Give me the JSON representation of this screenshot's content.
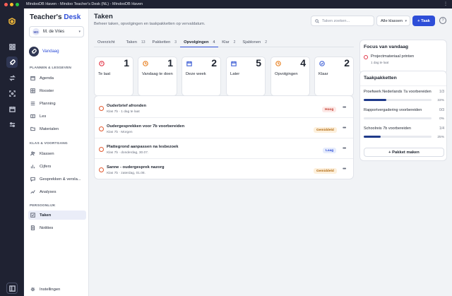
{
  "window": {
    "title": "MindooDB Haven - Mindoo Teacher's Desk (NL) - MindooDB Haven",
    "traffic": [
      "#ff5f57",
      "#febc2e",
      "#28c840"
    ]
  },
  "brand": {
    "main": "Teacher's ",
    "accent": "Desk",
    "accent_color": "#2e4ed8"
  },
  "user": {
    "initials": "MD",
    "name": "M. de Vries"
  },
  "rail_icons": [
    "logo-icon",
    "grid-icon",
    "rocket-icon",
    "arrows-icon",
    "focus-icon",
    "calendar-icon",
    "sliders-icon",
    "sidebar-toggle-icon"
  ],
  "sidebar": {
    "vandaag": "Vandaag",
    "sections": {
      "plannen": "PLANNEN & LESGEVEN",
      "klas": "KLAS & VOORTGANG",
      "persoonlijk": "PERSOONLIJK"
    },
    "plannen_items": [
      {
        "label": "Agenda",
        "icon": "calendar-icon"
      },
      {
        "label": "Rooster",
        "icon": "grid-icon"
      },
      {
        "label": "Planning",
        "icon": "list-icon"
      },
      {
        "label": "Les",
        "icon": "book-icon"
      },
      {
        "label": "Materialen",
        "icon": "folder-icon"
      }
    ],
    "klas_items": [
      {
        "label": "Klassen",
        "icon": "users-icon"
      },
      {
        "label": "Cijfers",
        "icon": "bar-chart-icon"
      },
      {
        "label": "Gesprekken & versla...",
        "icon": "chat-icon"
      },
      {
        "label": "Analyses",
        "icon": "trend-icon"
      }
    ],
    "persoonlijk_items": [
      {
        "label": "Taken",
        "icon": "checkbox-icon"
      },
      {
        "label": "Notities",
        "icon": "note-icon"
      }
    ],
    "settings": "Instellingen"
  },
  "header": {
    "title": "Taken",
    "subtitle": "Beheer taken, opvolgingen en taakpakketten op vervaldatum.",
    "search_placeholder": "Taken zoeken...",
    "filter": "Alle klassen",
    "add": "+ Taak",
    "help": "?"
  },
  "tabs": [
    {
      "label": "Overzicht",
      "count": ""
    },
    {
      "label": "Taken",
      "count": "13"
    },
    {
      "label": "Pakketten",
      "count": "3"
    },
    {
      "label": "Opvolgingen",
      "count": "4"
    },
    {
      "label": "Klar",
      "count": "2"
    },
    {
      "label": "Sjablonen",
      "count": "2"
    }
  ],
  "stats": [
    {
      "label": "Te laat",
      "value": "1",
      "icon": "alert-icon",
      "color": "#e2394a"
    },
    {
      "label": "Vandaag te doen",
      "value": "1",
      "icon": "clock-icon",
      "color": "#e8852a"
    },
    {
      "label": "Deze week",
      "value": "2",
      "icon": "calendar-icon",
      "color": "#4b6ad8"
    },
    {
      "label": "Later",
      "value": "5",
      "icon": "calendar-icon",
      "color": "#4b6ad8"
    },
    {
      "label": "Opvolgingen",
      "value": "4",
      "icon": "clock-icon",
      "color": "#e8852a"
    },
    {
      "label": "Klaar",
      "value": "2",
      "icon": "check-circle-icon",
      "color": "#4b6ad8"
    }
  ],
  "tasks": [
    {
      "title": "Ouderbrief afronden",
      "meta": "Klas 7b · 1 dag te laat",
      "badge": "Hoog",
      "badge_color": "#c0392b",
      "badge_bg": "#fde8e6"
    },
    {
      "title": "Oudergesprekken voor 7b voorbereiden",
      "meta": "Klas 7b · Morgen",
      "badge": "Gemiddeld",
      "badge_color": "#b36b12",
      "badge_bg": "#fdf0dc"
    },
    {
      "title": "Plattegrond aanpassen na lesbezoek",
      "meta": "Klas 7b · donderdag, 30.07.",
      "badge": "Laag",
      "badge_color": "#2e4ed8",
      "badge_bg": "#e6ecfc"
    },
    {
      "title": "Sanne - oudergesprek nazorg",
      "meta": "Klas 7b · zaterdag, 01.08.",
      "badge": "Gemiddeld",
      "badge_color": "#b36b12",
      "badge_bg": "#fdf0dc"
    }
  ],
  "focus": {
    "title": "Focus van vandaag",
    "item": "Projectmateriaal printen",
    "item_meta": "1 dag te laat"
  },
  "packages": {
    "title": "Taakpakketten",
    "items": [
      {
        "name": "Proefwerk Nederlands 7a voorbereiden",
        "count": "1/3",
        "percent": "33%",
        "progress": 0.33
      },
      {
        "name": "Rapportvergadering voorbereiden",
        "count": "0/3",
        "percent": "0%",
        "progress": 0
      },
      {
        "name": "Schoolreis 7b voorbereiden",
        "count": "1/4",
        "percent": "25%",
        "progress": 0.25
      }
    ],
    "button": "+ Pakket maken"
  }
}
